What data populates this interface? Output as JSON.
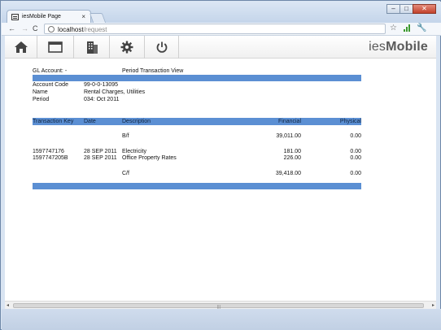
{
  "browser": {
    "tab_title": "iesMobile Page",
    "tab_close": "×",
    "url_host": "localhost",
    "url_path": "/request",
    "nav": {
      "back": "←",
      "forward": "→",
      "reload": "C"
    },
    "window_controls": {
      "minimize": "‒",
      "maximize": "□",
      "close": "✕"
    },
    "star": "☆",
    "wrench": "🔧"
  },
  "app": {
    "brand_light": "ies",
    "brand_bold": "Mobile",
    "toolbar_icons": [
      "home-icon",
      "window-icon",
      "building-icon",
      "gear-icon",
      "power-icon"
    ]
  },
  "report": {
    "gl_account_label": "GL Account: -",
    "view_title": "Period Transaction View",
    "fields": [
      {
        "label": "Account Code",
        "value": "99-0-0-13095"
      },
      {
        "label": "Name",
        "value": "Rental Charges, Utilities"
      },
      {
        "label": "Period",
        "value": "034: Oct 2011"
      }
    ],
    "columns": {
      "key": "Transaction Key",
      "date": "Date",
      "description": "Description",
      "financial": "Financial",
      "physical": "Physical"
    },
    "rows": [
      {
        "key": "",
        "date": "",
        "description": "B/f",
        "financial": "39,011.00",
        "physical": "0.00"
      },
      {
        "key": "1597747176",
        "date": "28 SEP 2011",
        "description": "Electricity",
        "financial": "181.00",
        "physical": "0.00"
      },
      {
        "key": "1597747205B",
        "date": "28 SEP 2011",
        "description": "Office Property Rates",
        "financial": "226.00",
        "physical": "0.00"
      },
      {
        "key": "",
        "date": "",
        "description": "C/f",
        "financial": "39,418.00",
        "physical": "0.00"
      }
    ]
  },
  "colors": {
    "header_blue": "#5b8fd3",
    "chrome": "#d9e4f2"
  }
}
